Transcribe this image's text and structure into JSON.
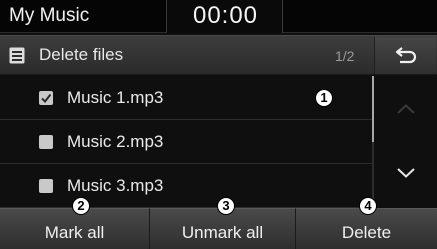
{
  "status_bar": {
    "app_title": "My Music",
    "clock": "00:00"
  },
  "header": {
    "icon": "list-icon",
    "title": "Delete files",
    "page_indicator": "1/2",
    "back_icon": "back-arrow-icon"
  },
  "file_list": {
    "items": [
      {
        "label": "Music 1.mp3",
        "checked": true
      },
      {
        "label": "Music 2.mp3",
        "checked": false
      },
      {
        "label": "Music 3.mp3",
        "checked": false
      }
    ],
    "scroll_position": 0.5
  },
  "bottom_buttons": {
    "mark_all": "Mark all",
    "unmark_all": "Unmark all",
    "delete": "Delete"
  },
  "callouts": {
    "list_item": "1",
    "mark_all": "2",
    "unmark_all": "3",
    "delete": "4"
  },
  "colors": {
    "background": "#0f0f0f",
    "button_gradient_top": "#4a4a4a",
    "checkbox": "#c9c9c9",
    "text": "#eaeaea"
  }
}
